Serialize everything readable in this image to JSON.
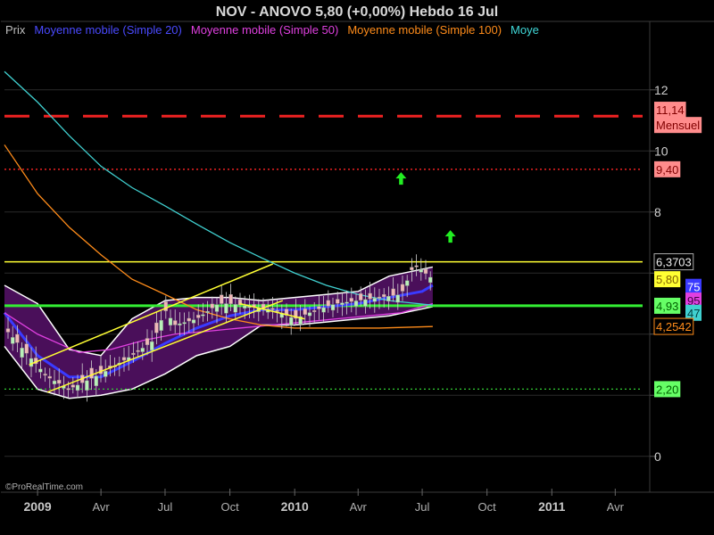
{
  "title": "NOV - ANOVO     5,80 (+0,00%)     Hebdo  16 Jul",
  "credit": "©ProRealTime.com",
  "legend": [
    {
      "label": "Prix",
      "color": "#bfbfbf"
    },
    {
      "label": "Moyenne mobile (Simple 20)",
      "color": "#4a4aff"
    },
    {
      "label": "Moyenne mobile (Simple 50)",
      "color": "#e040e0"
    },
    {
      "label": "Moyenne mobile (Simple 100)",
      "color": "#ff8c1a"
    },
    {
      "label": "Moye",
      "color": "#40d8d8"
    }
  ],
  "chart_data": {
    "type": "line",
    "title": "NOV - ANOVO     5,80 (+0,00%)     Hebdo  16 Jul",
    "y_axis": {
      "min": -1,
      "max": 13.6,
      "ticks": [
        0,
        2,
        4,
        6,
        8,
        10,
        12
      ],
      "labeled_ticks": [
        0,
        8,
        10,
        12
      ]
    },
    "x_axis": {
      "range": [
        "2008-11-15",
        "2011-05-20"
      ],
      "ticks": [
        {
          "date": "2009-01-01",
          "label": "2009",
          "bold": true
        },
        {
          "date": "2009-04-01",
          "label": "Avr",
          "bold": false
        },
        {
          "date": "2009-07-01",
          "label": "Jul",
          "bold": false
        },
        {
          "date": "2009-10-01",
          "label": "Oct",
          "bold": false
        },
        {
          "date": "2010-01-01",
          "label": "2010",
          "bold": true
        },
        {
          "date": "2010-04-01",
          "label": "Avr",
          "bold": false
        },
        {
          "date": "2010-07-01",
          "label": "Jul",
          "bold": false
        },
        {
          "date": "2010-10-01",
          "label": "Oct",
          "bold": false
        },
        {
          "date": "2011-01-01",
          "label": "2011",
          "bold": true
        },
        {
          "date": "2011-04-01",
          "label": "Avr",
          "bold": false
        }
      ]
    },
    "price": {
      "name": "Prix",
      "x": [
        "2008-11-15",
        "2009-01-15",
        "2009-02-15",
        "2009-04-01",
        "2009-05-15",
        "2009-06-15",
        "2009-07-01",
        "2009-07-15",
        "2009-08-15",
        "2009-09-15",
        "2009-10-01",
        "2009-11-01",
        "2009-12-01",
        "2010-01-01",
        "2010-02-01",
        "2010-03-01",
        "2010-04-01",
        "2010-05-01",
        "2010-06-01",
        "2010-06-20",
        "2010-07-05",
        "2010-07-16"
      ],
      "close": [
        4.2,
        2.6,
        2.2,
        2.7,
        3.3,
        3.8,
        4.8,
        4.3,
        4.5,
        5.0,
        5.0,
        4.9,
        4.8,
        4.5,
        4.8,
        5.0,
        5.1,
        5.2,
        5.3,
        6.3,
        6.0,
        5.8
      ]
    },
    "series": [
      {
        "name": "Moyenne mobile (Simple 20)",
        "color": "#3a3aff",
        "x": [
          "2008-11-15",
          "2009-01-01",
          "2009-02-15",
          "2009-04-01",
          "2009-05-15",
          "2009-07-01",
          "2009-08-15",
          "2009-10-01",
          "2009-11-15",
          "2010-01-01",
          "2010-02-15",
          "2010-04-01",
          "2010-05-15",
          "2010-07-01",
          "2010-07-16"
        ],
        "y": [
          4.7,
          3.3,
          2.6,
          2.6,
          3.1,
          3.7,
          4.2,
          4.6,
          4.8,
          4.8,
          4.9,
          5.0,
          5.2,
          5.4,
          5.6
        ]
      },
      {
        "name": "Moyenne mobile (Simple 50)",
        "color": "#e040e0",
        "x": [
          "2008-11-15",
          "2009-01-01",
          "2009-03-01",
          "2009-04-15",
          "2009-06-01",
          "2009-07-15",
          "2009-09-01",
          "2009-10-15",
          "2009-12-01",
          "2010-01-15",
          "2010-03-01",
          "2010-04-15",
          "2010-06-01",
          "2010-07-16"
        ],
        "y": [
          4.7,
          4.0,
          3.4,
          3.5,
          3.8,
          4.0,
          4.1,
          4.2,
          4.3,
          4.4,
          4.5,
          4.6,
          4.7,
          5.0
        ]
      },
      {
        "name": "Moyenne mobile (Simple 100)",
        "color": "#ff8c1a",
        "x": [
          "2008-11-15",
          "2009-01-01",
          "2009-02-15",
          "2009-04-01",
          "2009-05-15",
          "2009-07-01",
          "2009-08-15",
          "2009-10-01",
          "2009-11-15",
          "2010-01-01",
          "2010-03-01",
          "2010-05-01",
          "2010-07-16"
        ],
        "y": [
          10.2,
          8.6,
          7.5,
          6.6,
          5.8,
          5.3,
          4.8,
          4.5,
          4.3,
          4.2,
          4.2,
          4.2,
          4.25
        ]
      },
      {
        "name": "Moye",
        "color": "#40d0d0",
        "x": [
          "2008-11-15",
          "2009-01-01",
          "2009-02-15",
          "2009-04-01",
          "2009-05-15",
          "2009-07-01",
          "2009-08-15",
          "2009-10-01",
          "2009-11-15",
          "2010-01-01",
          "2010-02-15",
          "2010-04-01",
          "2010-05-15",
          "2010-07-16"
        ],
        "y": [
          12.6,
          11.6,
          10.5,
          9.5,
          8.8,
          8.2,
          7.6,
          7.0,
          6.5,
          6.0,
          5.6,
          5.3,
          5.1,
          4.95
        ]
      }
    ],
    "bollinger": {
      "color": "#4a0f5a",
      "x": [
        "2008-11-15",
        "2009-01-01",
        "2009-02-15",
        "2009-04-01",
        "2009-05-15",
        "2009-07-01",
        "2009-08-15",
        "2009-10-01",
        "2009-11-15",
        "2010-01-01",
        "2010-02-15",
        "2010-04-01",
        "2010-05-15",
        "2010-07-16"
      ],
      "upper": [
        5.6,
        5.0,
        3.5,
        3.3,
        4.5,
        5.1,
        5.2,
        5.2,
        5.1,
        5.2,
        5.3,
        5.4,
        5.9,
        6.2
      ],
      "lower": [
        3.6,
        2.2,
        1.9,
        2.0,
        2.2,
        2.7,
        3.3,
        3.6,
        4.3,
        4.3,
        4.4,
        4.5,
        4.6,
        4.9
      ]
    },
    "trendlines": [
      {
        "color": "#ffff33",
        "x": [
          "2008-12-20",
          "2009-12-01"
        ],
        "y": [
          3.0,
          6.3
        ]
      },
      {
        "color": "#ffff33",
        "x": [
          "2009-01-15",
          "2009-12-15"
        ],
        "y": [
          2.1,
          5.1
        ]
      },
      {
        "color": "#ffff33",
        "x": [
          "2009-10-15",
          "2010-01-15"
        ],
        "y": [
          5.0,
          4.5
        ]
      }
    ],
    "horizontal_lines": [
      {
        "name": "Mensuel",
        "y": 11.14,
        "color": "#ee2222",
        "style": "long-dash",
        "width": 3
      },
      {
        "y": 9.4,
        "color": "#ee2222",
        "style": "dotted",
        "width": 1.5
      },
      {
        "y": 6.3703,
        "color": "#ffff33",
        "style": "solid",
        "width": 1.5
      },
      {
        "y": 4.93,
        "color": "#33ee33",
        "style": "solid",
        "width": 3
      },
      {
        "y": 2.2,
        "color": "#33cc33",
        "style": "dotted",
        "width": 1.2
      }
    ],
    "arrows": [
      {
        "x": "2010-06-01",
        "y": 9.1,
        "color": "#22ee22"
      },
      {
        "x": "2010-08-10",
        "y": 7.2,
        "color": "#22ee22"
      }
    ],
    "price_labels": [
      {
        "text": "11,14",
        "y": 11.35,
        "bg": "#ff8c8c",
        "fg": "#800000"
      },
      {
        "text": "Mensuel",
        "y": 10.85,
        "bg": "#ff8c8c",
        "fg": "#800000"
      },
      {
        "text": "9,40",
        "y": 9.4,
        "bg": "#ff8c8c",
        "fg": "#800000"
      },
      {
        "text": "6,3703",
        "y": 6.3703,
        "bg": "#000000",
        "fg": "#eeeeee",
        "border": "#aaaaaa"
      },
      {
        "text": "5,80",
        "y": 5.8,
        "bg": "#ffff33",
        "fg": "#806000"
      },
      {
        "text": "75",
        "y": 5.55,
        "bg": "#3a3aff",
        "fg": "#ffffff"
      },
      {
        "text": "4,93",
        "y": 4.93,
        "bg": "#66ff66",
        "fg": "#006000"
      },
      {
        "text": "95",
        "y": 5.1,
        "bg": "#e040e0",
        "fg": "#400040"
      },
      {
        "text": "47",
        "y": 4.7,
        "bg": "#40d0d0",
        "fg": "#004040"
      },
      {
        "text": "4,2542",
        "y": 4.2542,
        "bg": "#000000",
        "fg": "#ff8c1a",
        "border": "#ff8c1a"
      },
      {
        "text": "2,20",
        "y": 2.2,
        "bg": "#66ff66",
        "fg": "#006000"
      }
    ]
  }
}
